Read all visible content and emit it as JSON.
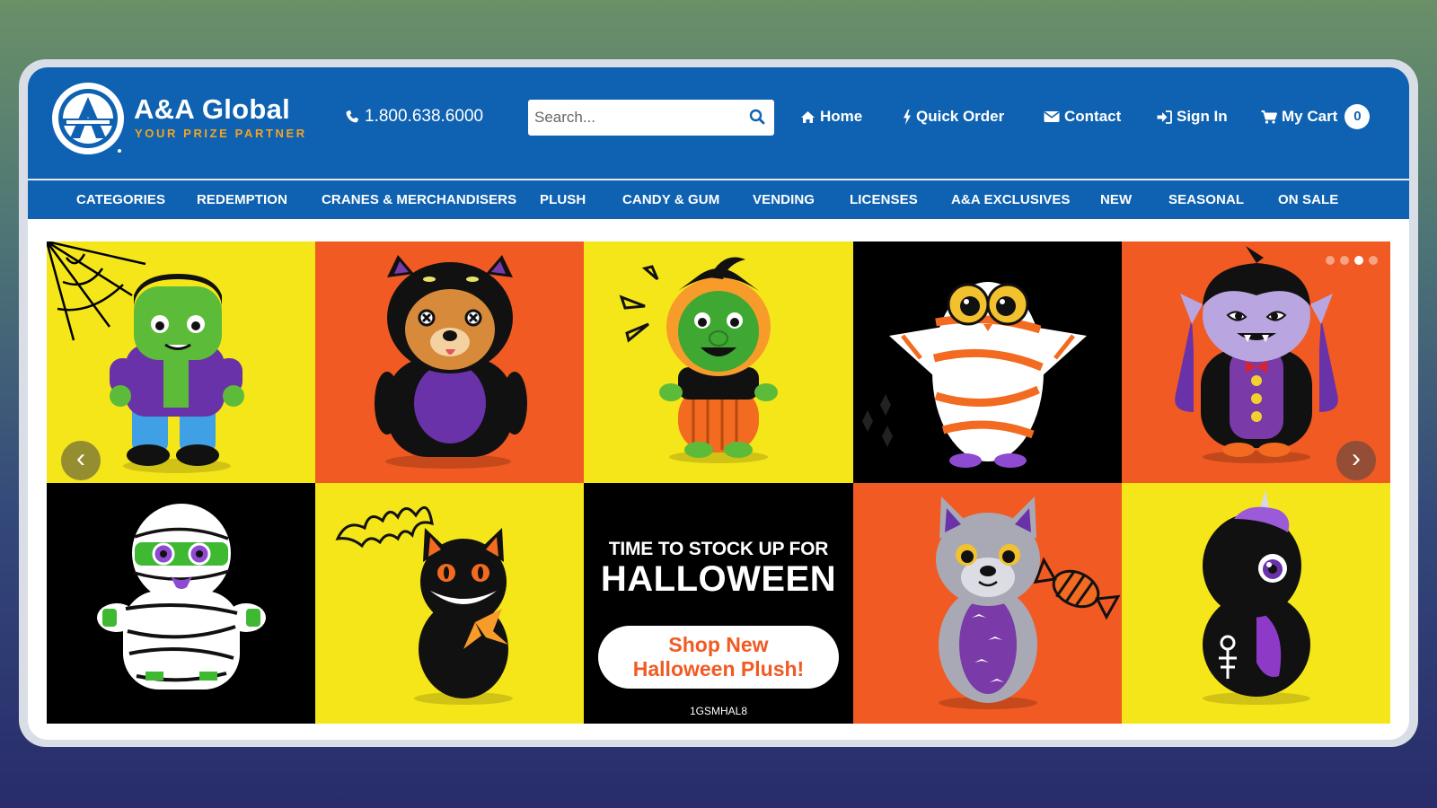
{
  "brand": {
    "name": "A&A Global",
    "tagline": "YOUR PRIZE PARTNER",
    "colors": {
      "header_blue": "#0f62b1",
      "tagline_orange": "#f4a423",
      "promo_orange": "#f15a22",
      "tile_yellow": "#f5e619"
    }
  },
  "header": {
    "phone": "1.800.638.6000",
    "phone_icon": "phone-icon",
    "search": {
      "placeholder": "Search...",
      "value": "",
      "icon": "search-icon"
    },
    "links": {
      "home": "Home",
      "quick_order": "Quick Order",
      "contact": "Contact",
      "sign_in": "Sign In",
      "my_cart": "My Cart"
    },
    "cart_count": "0"
  },
  "nav": {
    "items": [
      "CATEGORIES",
      "REDEMPTION",
      "CRANES & MERCHANDISERS",
      "PLUSH",
      "CANDY & GUM",
      "VENDING",
      "LICENSES",
      "A&A EXCLUSIVES",
      "NEW",
      "SEASONAL",
      "ON SALE"
    ]
  },
  "banner": {
    "promo_line1": "TIME TO STOCK UP FOR",
    "promo_line2": "HALLOWEEN",
    "button_line1": "Shop New",
    "button_line2": "Halloween Plush!",
    "sku": "1GSMHAL8",
    "prev_arrow": "‹",
    "next_arrow": "›",
    "slide_count": 4,
    "active_slide": 3,
    "tiles": [
      "frankenstein-plush",
      "bear-cat-costume-plush",
      "witch-plush",
      "mummy-owl-plush",
      "vampire-plush",
      "mummy-plush",
      "black-cat-plush",
      "halloween-promo",
      "wolf-plush",
      "black-unicorn-plush"
    ]
  }
}
